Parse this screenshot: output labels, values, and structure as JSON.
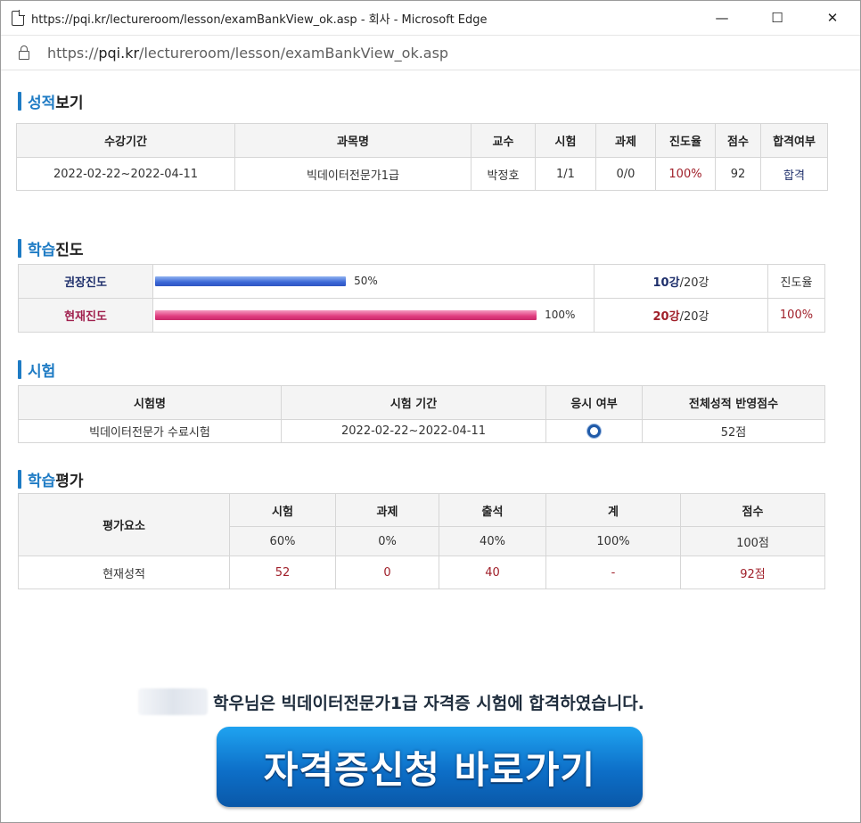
{
  "window": {
    "title": "https://pqi.kr/lectureroom/lesson/examBankView_ok.asp - 회사 - Microsoft Edge",
    "minimize": "—",
    "maximize": "☐",
    "close": "✕"
  },
  "address": {
    "prefix": "https://",
    "domain": "pqi.kr",
    "path": "/lectureroom/lesson/examBankView_ok.asp"
  },
  "sections": {
    "grades": {
      "hl": "성적",
      "rest": "보기"
    },
    "progress": {
      "hl": "학습",
      "rest": "진도"
    },
    "exam": {
      "hl": "시험",
      "rest": ""
    },
    "evaluation": {
      "hl": "학습",
      "rest": "평가"
    }
  },
  "grades": {
    "headers": [
      "수강기간",
      "과목명",
      "교수",
      "시험",
      "과제",
      "진도율",
      "점수",
      "합격여부"
    ],
    "row": [
      "2022-02-22~2022-04-11",
      "빅데이터전문가1급",
      "박정호",
      "1/1",
      "0/0",
      "100%",
      "92",
      "합격"
    ]
  },
  "progress": {
    "rows": [
      {
        "label": "권장진도",
        "pct_text": "50%",
        "fraction": 0.5,
        "done": "10강",
        "total": "/20강",
        "extra": "진도율"
      },
      {
        "label": "현재진도",
        "pct_text": "100%",
        "fraction": 1.0,
        "done": "20강",
        "total": "/20강",
        "extra": "100%"
      }
    ]
  },
  "exam": {
    "headers": [
      "시험명",
      "시험 기간",
      "응시 여부",
      "전체성적 반영점수"
    ],
    "row": {
      "name": "빅데이터전문가 수료시험",
      "period": "2022-02-22~2022-04-11",
      "taken": "taken-circle-icon",
      "score": "52점"
    }
  },
  "evaluation": {
    "row_header": "평가요소",
    "headers": [
      "시험",
      "과제",
      "출석",
      "계",
      "점수"
    ],
    "weights": [
      "60%",
      "0%",
      "40%",
      "100%",
      "100점"
    ],
    "current_label": "현재성적",
    "current": [
      "52",
      "0",
      "40",
      "-",
      "92점"
    ]
  },
  "message": "학우님은 빅데이터전문가1급 자격증 시험에 합격하였습니다.",
  "cta_label": "자격증신청 바로가기",
  "colors": {
    "accent": "#1e7bc4",
    "red": "#a0202a",
    "navy": "#1e2f6b"
  }
}
